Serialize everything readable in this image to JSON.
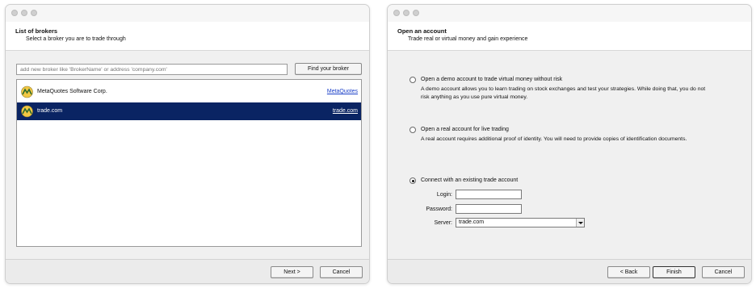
{
  "brokers_window": {
    "title": "List of brokers",
    "subtitle": "Select a broker you are to trade through",
    "search": {
      "placeholder": "add new broker like 'BrokerName' or address 'company.com'",
      "value": ""
    },
    "find_button": "Find your broker",
    "brokers": [
      {
        "name": "MetaQuotes Software Corp.",
        "link": "MetaQuotes",
        "selected": false
      },
      {
        "name": "trade.com",
        "link": "trade.com",
        "selected": true
      }
    ],
    "next_button": "Next >",
    "cancel_button": "Cancel"
  },
  "account_window": {
    "title": "Open an account",
    "subtitle": "Trade real or virtual money and gain experience",
    "options": [
      {
        "label": "Open a demo account to trade virtual money without risk",
        "description_line1": "A demo account allows you to learn trading on stock exchanges and test your strategies. While doing that, you do not",
        "description_line2": "risk anything as you use pure virtual money.",
        "selected": false
      },
      {
        "label": "Open a real account for live trading",
        "description_line1": "A real account requires additional proof of identity. You will need to provide copies of identification documents.",
        "selected": false
      },
      {
        "label": "Connect with an existing trade account",
        "selected": true
      }
    ],
    "login_label": "Login:",
    "login_value": "",
    "password_label": "Password:",
    "password_value": "",
    "server_label": "Server:",
    "server_value": "trade.com",
    "back_button": "< Back",
    "finish_button": "Finish",
    "cancel_button": "Cancel"
  },
  "colors": {
    "selected_row": "#0a2463",
    "link": "#1a3fc8"
  },
  "icons": {
    "broker_logo": "metaquotes-logo-icon",
    "dropdown": "chevron-down-icon"
  }
}
